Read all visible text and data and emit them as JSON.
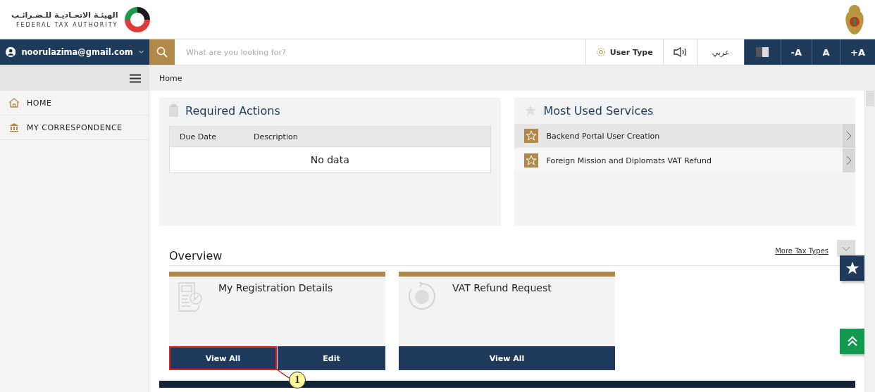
{
  "logo": {
    "arabic": "الهيئـة الاتحـاديـة للـضـرائـب",
    "english": "FEDERAL TAX AUTHORITY"
  },
  "toolbar": {
    "user": "noorulazima@gmail.com",
    "search": {
      "placeholder": "What are you looking for?"
    },
    "user_type": "User Type",
    "language": "عربي",
    "font_buttons": [
      "-A",
      "A",
      "+A"
    ]
  },
  "breadcrumb": "Home",
  "sidebar": {
    "items": [
      {
        "label": "HOME",
        "kind": "home"
      },
      {
        "label": "MY CORRESPONDENCE",
        "kind": "bank"
      }
    ]
  },
  "required_actions": {
    "title": "Required Actions",
    "columns": [
      "Due Date",
      "Description"
    ],
    "empty_text": "No data"
  },
  "most_used_services": {
    "title": "Most Used Services",
    "items": [
      {
        "label": "Backend Portal User Creation",
        "highlighted": true
      },
      {
        "label": "Foreign Mission and Diplomats VAT Refund",
        "highlighted": false
      }
    ]
  },
  "overview": {
    "title": "Overview",
    "link": "More Tax Types",
    "tiles": [
      {
        "title": "My Registration Details",
        "kind": "document",
        "buttons": [
          {
            "label": "View All",
            "highlighted": true
          },
          {
            "label": "Edit",
            "highlighted": false
          }
        ]
      },
      {
        "title": "VAT Refund Request",
        "kind": "refund",
        "buttons": [
          {
            "label": "View All",
            "highlighted": false
          }
        ]
      }
    ]
  },
  "callout": {
    "number": "1"
  }
}
